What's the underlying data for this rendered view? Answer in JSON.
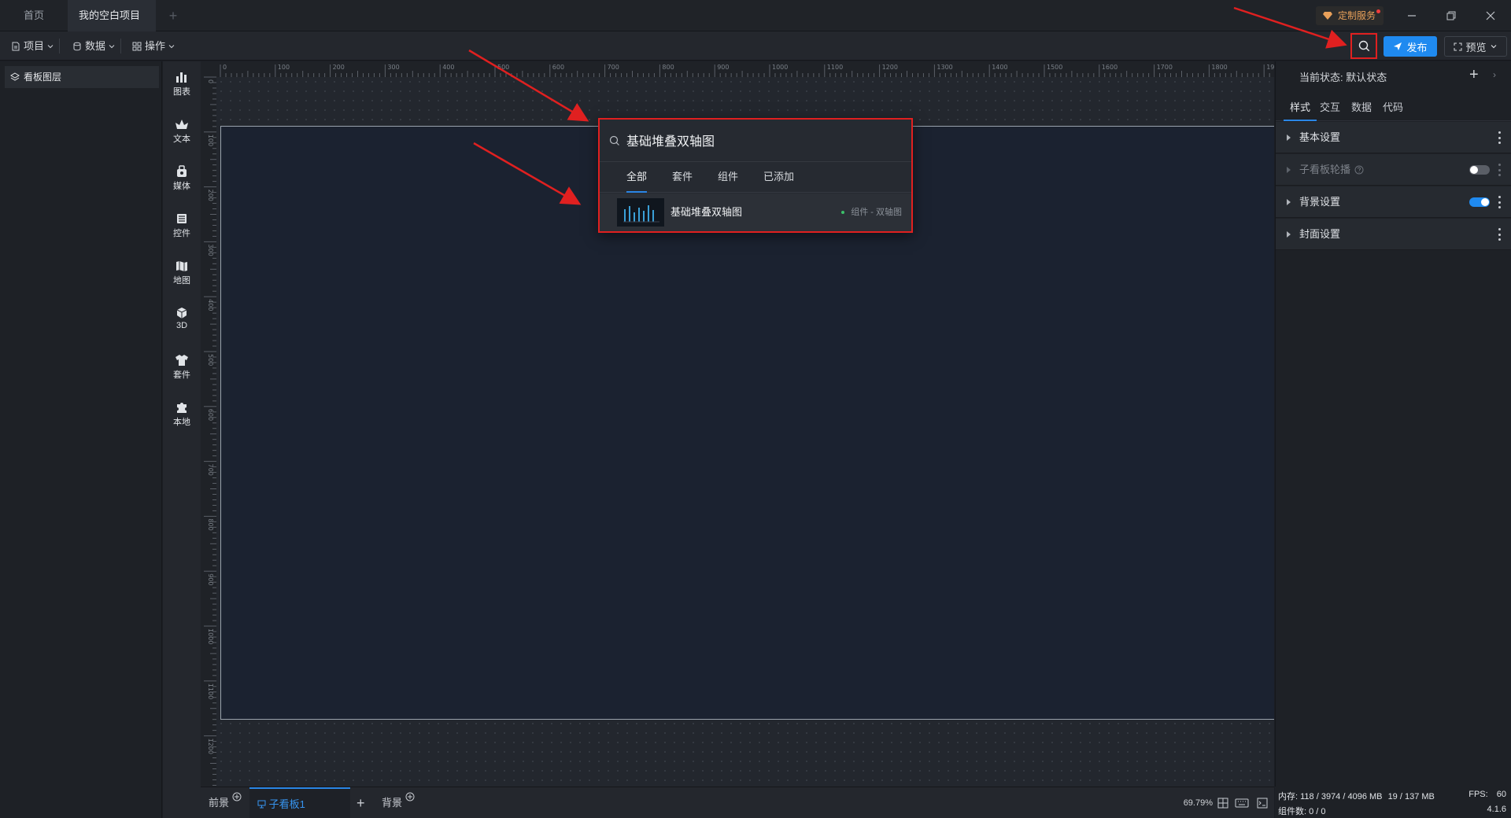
{
  "titlebar": {
    "tabs": [
      {
        "label": "首页"
      },
      {
        "label": "我的空白项目"
      }
    ],
    "custom_service": "定制服务"
  },
  "toolbar": {
    "menus": [
      {
        "label": "项目",
        "icon": "file-icon"
      },
      {
        "label": "数据",
        "icon": "database-icon"
      },
      {
        "label": "操作",
        "icon": "grid-icon"
      }
    ],
    "publish_label": "发布",
    "preview_label": "预览"
  },
  "layer_panel": {
    "title": "看板图层"
  },
  "component_sidebar": {
    "items": [
      {
        "label": "图表",
        "icon": "bar-chart-icon"
      },
      {
        "label": "文本",
        "icon": "text-icon"
      },
      {
        "label": "媒体",
        "icon": "media-icon"
      },
      {
        "label": "控件",
        "icon": "widget-icon"
      },
      {
        "label": "地图",
        "icon": "map-icon"
      },
      {
        "label": "3D",
        "icon": "cube-icon"
      },
      {
        "label": "套件",
        "icon": "shirt-icon"
      },
      {
        "label": "本地",
        "icon": "puzzle-icon"
      }
    ]
  },
  "ruler": {
    "top_labels": [
      "0",
      "100",
      "200",
      "300",
      "400",
      "500",
      "600",
      "700",
      "800",
      "900",
      "1000",
      "1100",
      "1200",
      "1300",
      "1400",
      "1500",
      "1600",
      "1700",
      "1800",
      "1900"
    ],
    "left_labels": [
      "0",
      "100",
      "200",
      "300",
      "400",
      "500",
      "600",
      "700",
      "800",
      "900",
      "1000",
      "1100",
      "1200"
    ]
  },
  "search_popup": {
    "query": "基础堆叠双轴图",
    "tabs": [
      "全部",
      "套件",
      "组件",
      "已添加"
    ],
    "results": [
      {
        "name": "基础堆叠双轴图",
        "meta": "组件 - 双轴图"
      }
    ]
  },
  "bottom_bar": {
    "foreground": "前景",
    "board_tab": "子看板1",
    "background": "背景",
    "zoom": "69.79%"
  },
  "right_panel": {
    "state_label": "当前状态:",
    "state_value": "默认状态",
    "tabs": [
      "样式",
      "交互",
      "数据",
      "代码"
    ],
    "sections": [
      {
        "label": "基本设置",
        "enabled": true,
        "toggle": null
      },
      {
        "label": "子看板轮播",
        "enabled": false,
        "toggle": false
      },
      {
        "label": "背景设置",
        "enabled": true,
        "toggle": true
      },
      {
        "label": "封面设置",
        "enabled": true,
        "toggle": null
      }
    ]
  },
  "status": {
    "memory_label": "内存:",
    "memory_value": "118 / 3974 / 4096 MB",
    "memory_secondary": "19 / 137 MB",
    "fps_label": "FPS:",
    "fps_value": "60",
    "component_count_label": "组件数:",
    "component_count_value": "0 / 0",
    "version": "4.1.6"
  },
  "colors": {
    "accent": "#1f8af0",
    "highlight": "#e02020",
    "modified_dot": "#f0a030"
  }
}
